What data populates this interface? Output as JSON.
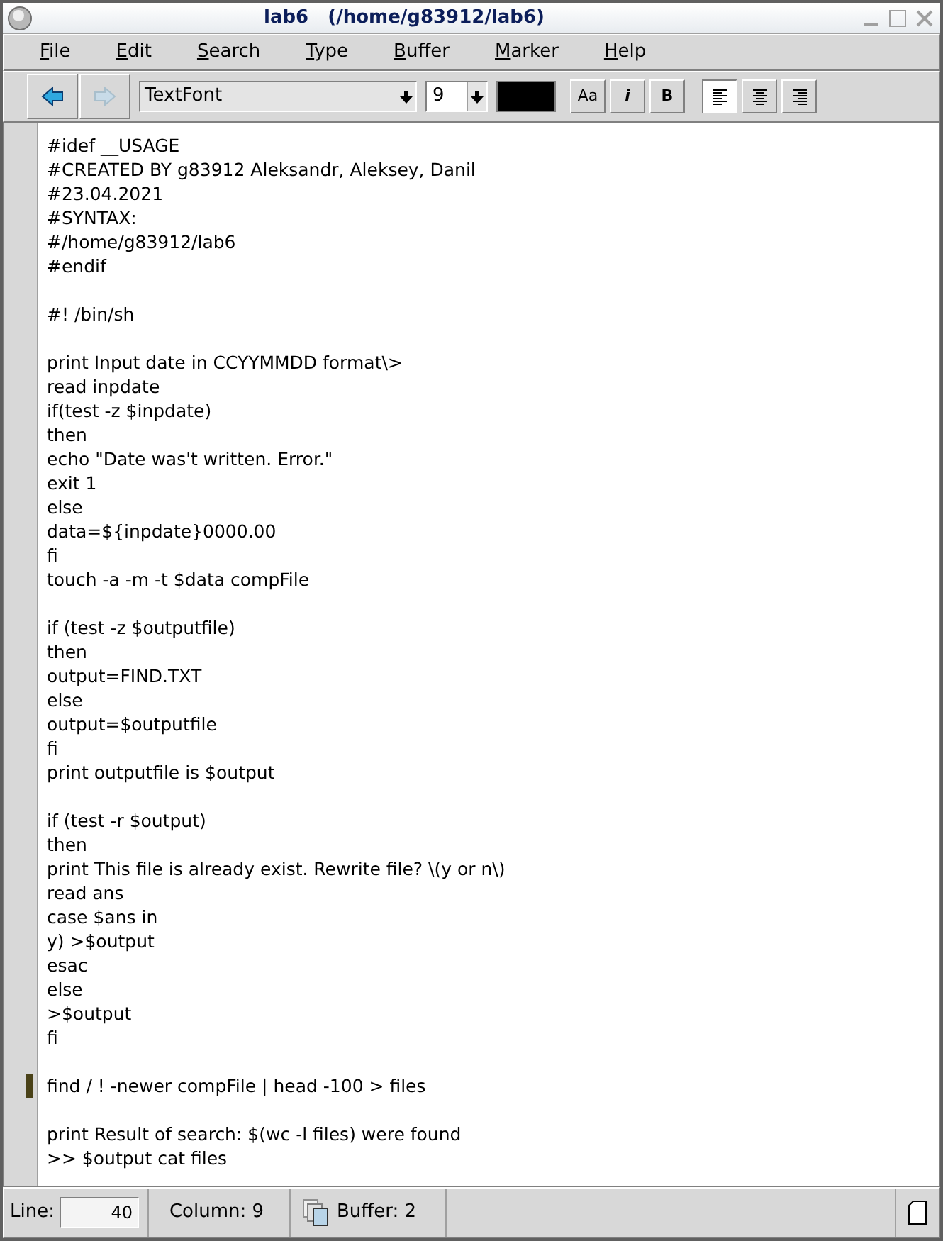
{
  "window": {
    "title": "lab6   (/home/g83912/lab6)"
  },
  "menu": [
    {
      "label": "File"
    },
    {
      "label": "Edit"
    },
    {
      "label": "Search"
    },
    {
      "label": "Type"
    },
    {
      "label": "Buffer"
    },
    {
      "label": "Marker"
    },
    {
      "label": "Help"
    }
  ],
  "toolbar": {
    "back_disabled": false,
    "forward_disabled": true,
    "font": "TextFont",
    "size": "9",
    "color": "#000000",
    "style_buttons": [
      {
        "label": "Aa",
        "kind": "case"
      },
      {
        "label": "i",
        "kind": "italic"
      },
      {
        "label": "B",
        "kind": "bold"
      }
    ],
    "alignments": [
      {
        "kind": "left",
        "selected": true
      },
      {
        "kind": "center",
        "selected": false
      },
      {
        "kind": "right",
        "selected": false
      }
    ]
  },
  "lines": [
    {
      "kind": "text",
      "text": "#idef __USAGE",
      "marked": false
    },
    {
      "kind": "text",
      "text": "#CREATED BY g83912 Aleksandr, Aleksey, Danil",
      "marked": false
    },
    {
      "kind": "text",
      "text": "#23.04.2021",
      "marked": false
    },
    {
      "kind": "text",
      "text": "#SYNTAX:",
      "marked": false
    },
    {
      "kind": "text",
      "text": "#/home/g83912/lab6",
      "marked": false
    },
    {
      "kind": "text",
      "text": "#endif",
      "marked": false
    },
    {
      "kind": "blank"
    },
    {
      "kind": "text",
      "text": "#! /bin/sh",
      "marked": false
    },
    {
      "kind": "blank"
    },
    {
      "kind": "text",
      "text": "print Input date in CCYYMMDD format\\>",
      "marked": false
    },
    {
      "kind": "text",
      "text": "read inpdate",
      "marked": false
    },
    {
      "kind": "text",
      "text": "if(test -z $inpdate)",
      "marked": false
    },
    {
      "kind": "text",
      "text": "then",
      "marked": false
    },
    {
      "kind": "text",
      "text": "echo \"Date was't written. Error.\"",
      "marked": false
    },
    {
      "kind": "text",
      "text": "exit 1",
      "marked": false
    },
    {
      "kind": "text",
      "text": "else",
      "marked": false
    },
    {
      "kind": "text",
      "text": "data=${inpdate}0000.00",
      "marked": false
    },
    {
      "kind": "text",
      "text": "fi",
      "marked": false
    },
    {
      "kind": "text",
      "text": "touch -a -m -t $data compFile",
      "marked": false
    },
    {
      "kind": "blank"
    },
    {
      "kind": "text",
      "text": "if (test -z $outputfile)",
      "marked": false
    },
    {
      "kind": "text",
      "text": "then",
      "marked": false
    },
    {
      "kind": "text",
      "text": "output=FIND.TXT",
      "marked": false
    },
    {
      "kind": "text",
      "text": "else",
      "marked": false
    },
    {
      "kind": "text",
      "text": "output=$outputfile",
      "marked": false
    },
    {
      "kind": "text",
      "text": "fi",
      "marked": false
    },
    {
      "kind": "text",
      "text": "print outputfile is $output",
      "marked": false
    },
    {
      "kind": "blank"
    },
    {
      "kind": "text",
      "text": "if (test -r $output)",
      "marked": false
    },
    {
      "kind": "text",
      "text": "then",
      "marked": false
    },
    {
      "kind": "text",
      "text": "print This file is already exist. Rewrite file? \\(y or n\\)",
      "marked": false
    },
    {
      "kind": "text",
      "text": "read ans",
      "marked": false
    },
    {
      "kind": "text",
      "text": "case $ans in",
      "marked": false
    },
    {
      "kind": "text",
      "text": "y) >$output",
      "marked": false
    },
    {
      "kind": "text",
      "text": "esac",
      "marked": false
    },
    {
      "kind": "text",
      "text": "else",
      "marked": false
    },
    {
      "kind": "text",
      "text": ">$output",
      "marked": false
    },
    {
      "kind": "text",
      "text": "fi",
      "marked": false
    },
    {
      "kind": "blank"
    },
    {
      "kind": "text",
      "text": "find / ! -newer compFile | head -100 > files",
      "marked": true
    },
    {
      "kind": "blank"
    },
    {
      "kind": "text",
      "text": "print Result of search: $(wc -l files) were found",
      "marked": false
    },
    {
      "kind": "text",
      "text": ">> $output cat files",
      "marked": false
    }
  ],
  "status_bar": {
    "line_label": "Line:",
    "line_value": "40",
    "column": "Column: 9",
    "buffer": "Buffer: 2"
  }
}
